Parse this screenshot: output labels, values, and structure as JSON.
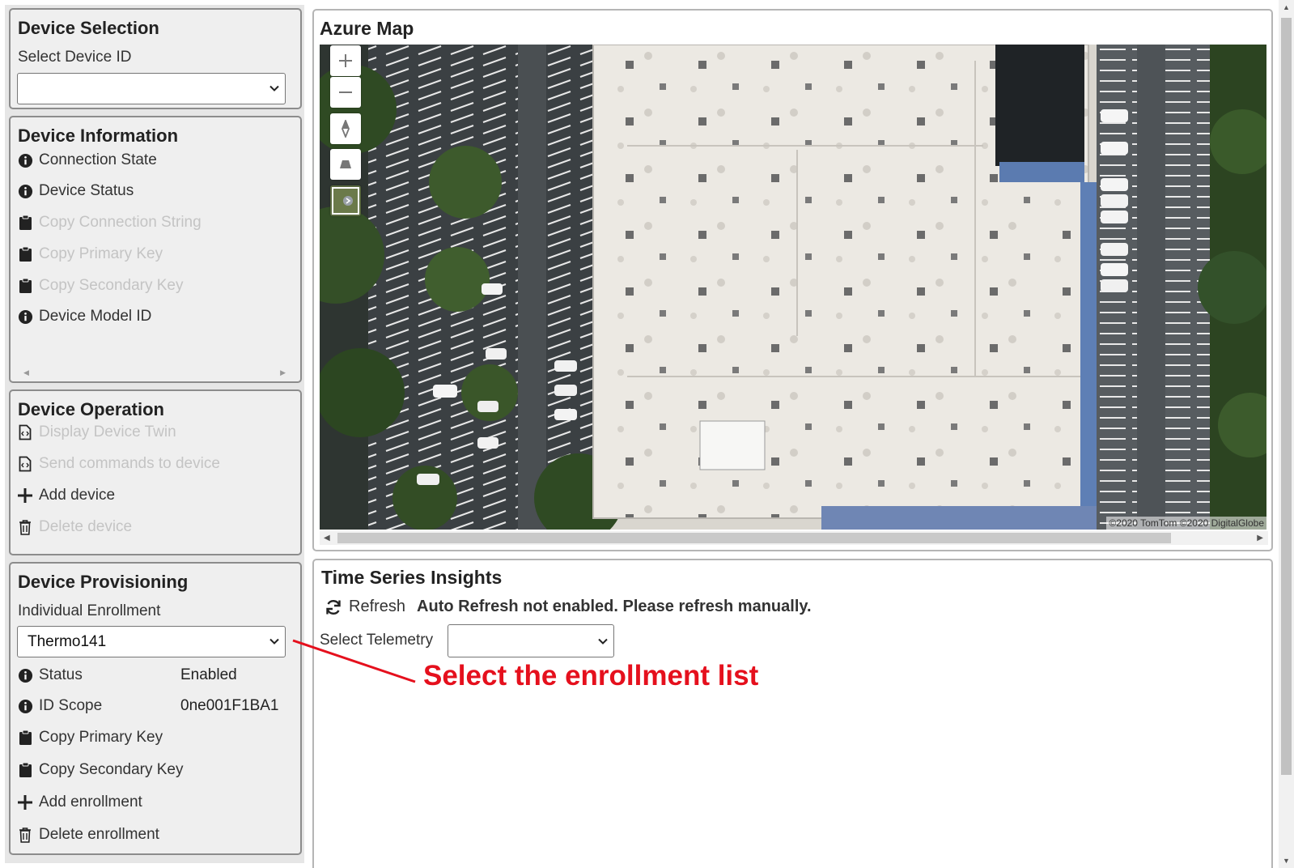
{
  "sidebar": {
    "device_selection": {
      "title": "Device Selection",
      "select_label": "Select Device ID",
      "selected_value": ""
    },
    "device_information": {
      "title": "Device Information",
      "items": [
        {
          "label": "Connection State",
          "icon": "info-icon",
          "enabled": true
        },
        {
          "label": "Device Status",
          "icon": "info-icon",
          "enabled": true
        },
        {
          "label": "Copy Connection String",
          "icon": "clipboard-icon",
          "enabled": false
        },
        {
          "label": "Copy Primary Key",
          "icon": "clipboard-icon",
          "enabled": false
        },
        {
          "label": "Copy Secondary Key",
          "icon": "clipboard-icon",
          "enabled": false
        },
        {
          "label": "Device Model ID",
          "icon": "info-icon",
          "enabled": true
        }
      ]
    },
    "device_operation": {
      "title": "Device Operation",
      "items": [
        {
          "label": "Display Device Twin",
          "icon": "code-file-icon",
          "enabled": false
        },
        {
          "label": "Send commands to device",
          "icon": "code-file-icon",
          "enabled": false
        },
        {
          "label": "Add device",
          "icon": "plus-icon",
          "enabled": true
        },
        {
          "label": "Delete device",
          "icon": "trash-icon",
          "enabled": false
        }
      ]
    },
    "device_provisioning": {
      "title": "Device Provisioning",
      "enrollment_label": "Individual Enrollment",
      "enrollment_selected": "Thermo141",
      "status_label": "Status",
      "status_value": "Enabled",
      "id_scope_label": "ID Scope",
      "id_scope_value": "0ne001F1BA1",
      "actions": [
        {
          "label": "Copy Primary Key",
          "icon": "clipboard-icon"
        },
        {
          "label": "Copy Secondary Key",
          "icon": "clipboard-icon"
        },
        {
          "label": "Add enrollment",
          "icon": "plus-icon"
        },
        {
          "label": "Delete enrollment",
          "icon": "trash-icon"
        }
      ]
    }
  },
  "map": {
    "title": "Azure Map",
    "attribution": "©2020 TomTom ©2020 DigitalGlobe",
    "controls": [
      "zoom-in-icon",
      "zoom-out-icon",
      "compass-icon",
      "pitch-icon",
      "map-style-icon"
    ]
  },
  "tsi": {
    "title": "Time Series Insights",
    "refresh_label": "Refresh",
    "refresh_note": "Auto Refresh not enabled. Please refresh manually.",
    "telemetry_label": "Select Telemetry",
    "telemetry_selected": ""
  },
  "annotation": {
    "text": "Select the enrollment list",
    "color": "#e5101d"
  }
}
